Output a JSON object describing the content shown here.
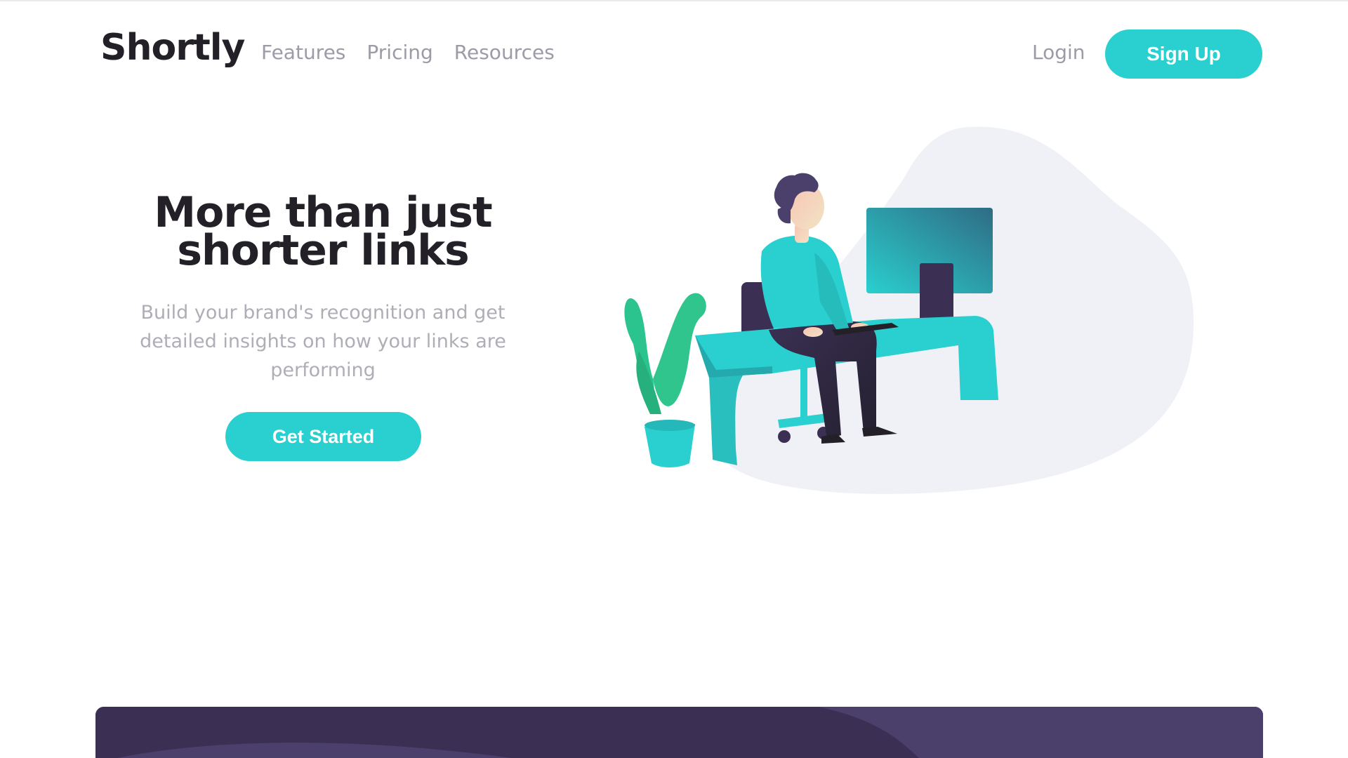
{
  "header": {
    "logo": "Shortly",
    "nav": [
      "Features",
      "Pricing",
      "Resources"
    ],
    "login": "Login",
    "signup": "Sign Up"
  },
  "hero": {
    "title_line1": "More than just",
    "title_line2": "shorter links",
    "subtitle": "Build your brand's recognition and get detailed insights on how your links are performing",
    "cta": "Get Started"
  },
  "colors": {
    "primary_cyan": "#2acfcf",
    "dark_violet": "#3b3054",
    "heading": "#232127",
    "nav_gray": "#9e9aa7",
    "blob_gray": "#f0f1f6"
  },
  "illustration": {
    "name": "person-working-at-desk"
  }
}
